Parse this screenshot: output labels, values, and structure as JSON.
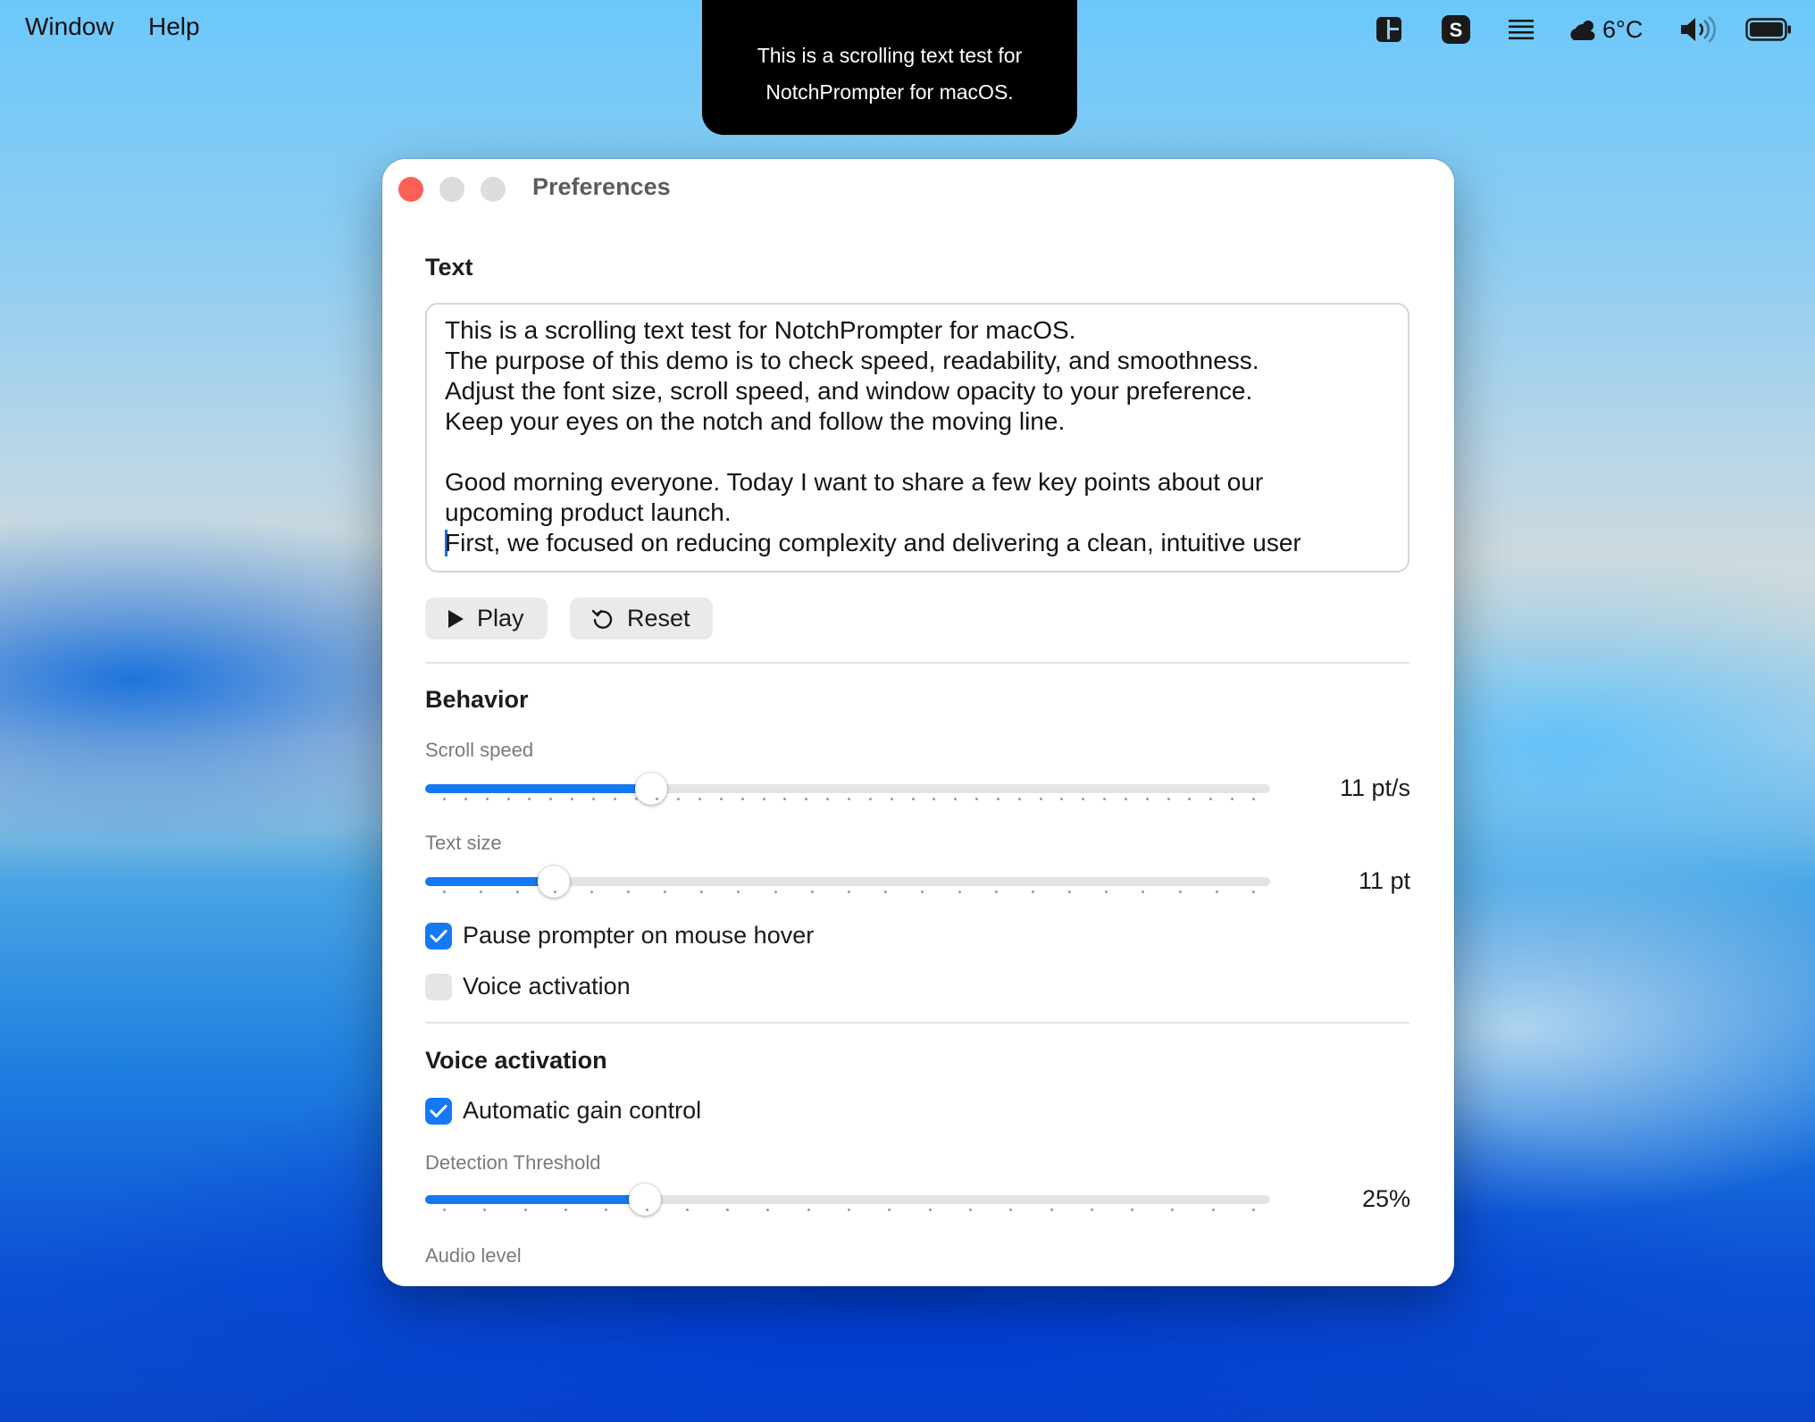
{
  "menubar": {
    "items": [
      "Window",
      "Help"
    ],
    "weather": "6°C"
  },
  "notch": {
    "line1": "This is a scrolling text test for",
    "line2": "NotchPrompter for macOS."
  },
  "window": {
    "title": "Preferences",
    "text_section": {
      "title": "Text",
      "lines": [
        "This is a scrolling text test for NotchPrompter for macOS.",
        "The purpose of this demo is to check speed, readability, and smoothness.",
        "Adjust the font size, scroll speed, and window opacity to your preference.",
        "Keep your eyes on the notch and follow the moving line.",
        "",
        "Good morning everyone. Today I want to share a few key points about our",
        "upcoming product launch.",
        "First, we focused on reducing complexity and delivering a clean, intuitive user"
      ],
      "play_label": "Play",
      "reset_label": "Reset"
    },
    "behavior": {
      "title": "Behavior",
      "scroll_speed": {
        "label": "Scroll speed",
        "value_text": "11 pt/s",
        "fraction": 0.267
      },
      "text_size": {
        "label": "Text size",
        "value_text": "11 pt",
        "fraction": 0.152
      },
      "pause_on_hover": {
        "label": "Pause prompter on mouse hover",
        "checked": true
      },
      "voice_activation": {
        "label": "Voice activation",
        "checked": false
      }
    },
    "voice_section": {
      "title": "Voice activation",
      "agc": {
        "label": "Automatic gain control",
        "checked": true
      },
      "threshold": {
        "label": "Detection Threshold",
        "value_text": "25%",
        "fraction": 0.26
      },
      "audio_level": {
        "label": "Audio level"
      }
    }
  },
  "colors": {
    "accent": "#1578f5",
    "close": "#fe5f57"
  },
  "icons": [
    "layout-icon",
    "s-app-icon",
    "list-icon",
    "cloud-sun-icon",
    "volume-icon",
    "battery-icon",
    "play-icon",
    "reset-icon",
    "checkmark-icon"
  ]
}
